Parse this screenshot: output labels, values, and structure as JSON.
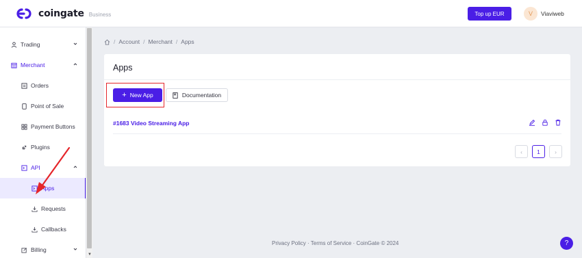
{
  "header": {
    "brand": "coingate",
    "brand_sub": "Business",
    "topup_label": "Top up EUR",
    "avatar_initial": "V",
    "username": "Viaviweb"
  },
  "sidebar": {
    "items": [
      {
        "label": "Trading",
        "icon": "user-icon"
      },
      {
        "label": "Merchant",
        "icon": "store-icon"
      },
      {
        "label": "Orders",
        "icon": "orders-icon"
      },
      {
        "label": "Point of Sale",
        "icon": "tablet-icon"
      },
      {
        "label": "Payment Buttons",
        "icon": "grid-icon"
      },
      {
        "label": "Plugins",
        "icon": "plug-icon"
      },
      {
        "label": "API",
        "icon": "terminal-icon"
      },
      {
        "label": "Apps",
        "icon": "terminal-icon"
      },
      {
        "label": "Requests",
        "icon": "download-icon"
      },
      {
        "label": "Callbacks",
        "icon": "download-icon"
      },
      {
        "label": "Billing",
        "icon": "edit-icon"
      }
    ]
  },
  "breadcrumb": {
    "items": [
      "Account",
      "Merchant",
      "Apps"
    ],
    "separator": "/"
  },
  "main": {
    "title": "Apps",
    "new_app_label": "New App",
    "new_app_icon": "+",
    "documentation_label": "Documentation",
    "apps": [
      {
        "name": "#1683 Video Streaming App"
      }
    ],
    "pagination": {
      "prev": "‹",
      "current": "1",
      "next": "›"
    }
  },
  "footer": {
    "text": "Privacy Policy · Terms of Service · CoinGate © 2024"
  },
  "help_label": "?",
  "colors": {
    "accent": "#4a1ee6",
    "annotation": "#e5252a"
  }
}
